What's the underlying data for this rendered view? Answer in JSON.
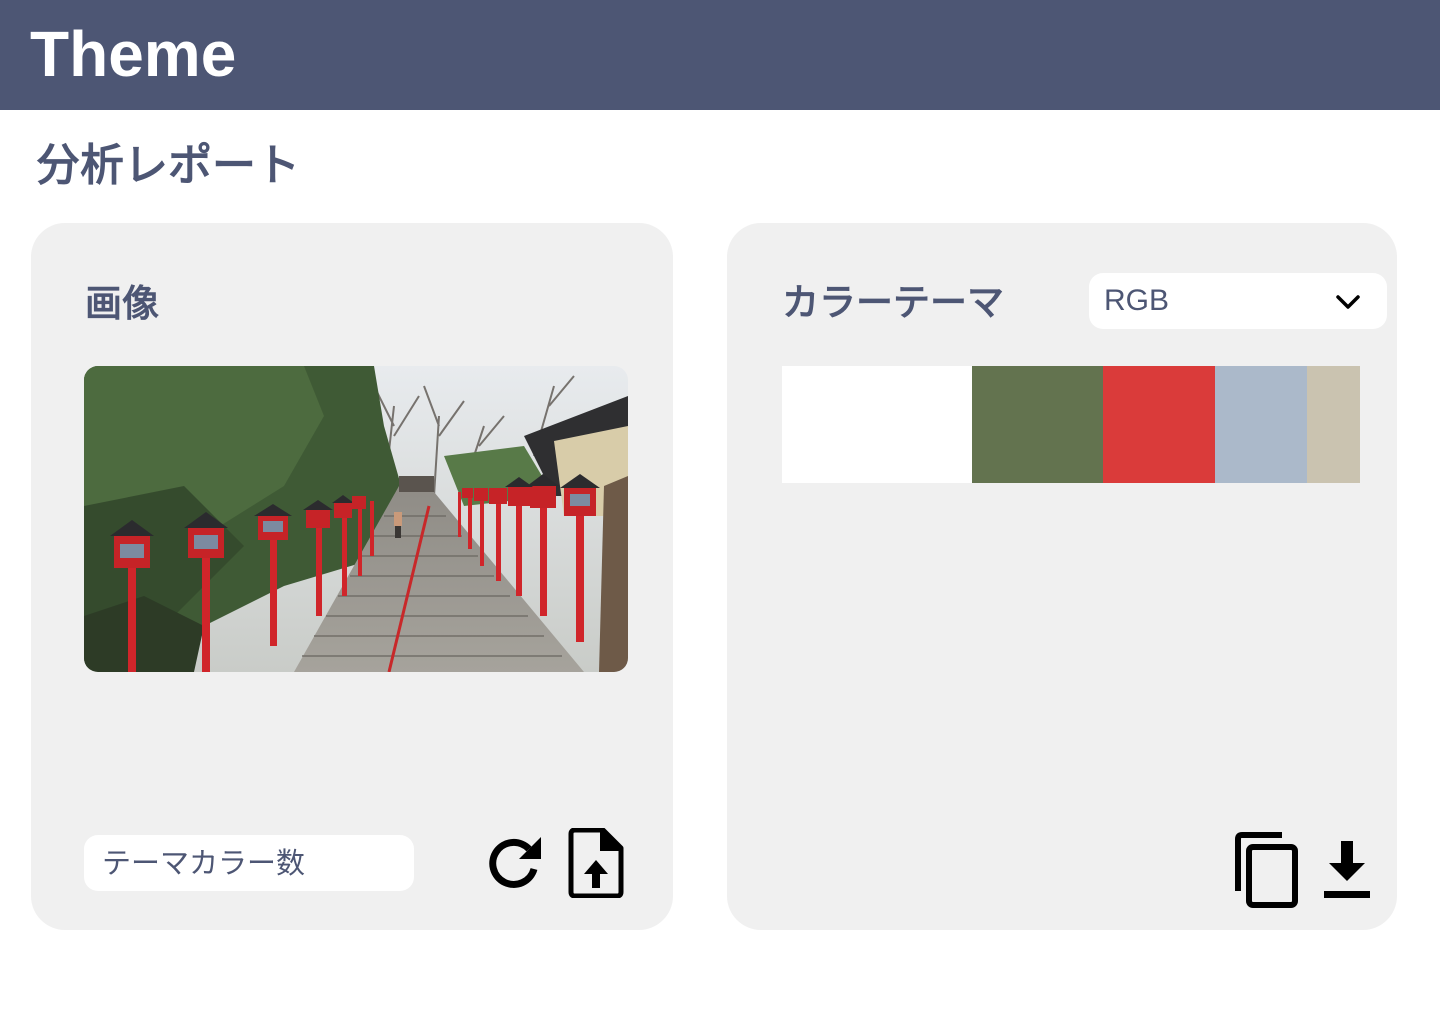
{
  "app": {
    "title": "Theme"
  },
  "page": {
    "title": "分析レポート"
  },
  "image_panel": {
    "heading": "画像",
    "photo_alt": "Shrine stone staircase lined with red lanterns",
    "theme_count_placeholder": "テーマカラー数",
    "icons": {
      "refresh": "refresh-icon",
      "upload": "file-upload-icon"
    }
  },
  "theme_panel": {
    "heading": "カラーテーマ",
    "format_select": {
      "value": "RGB",
      "options": [
        "RGB"
      ]
    },
    "icons": {
      "copy": "copy-icon",
      "download": "download-icon",
      "chevron": "chevron-down-icon"
    },
    "palette": [
      {
        "color": "#ffffff",
        "share": 0.328
      },
      {
        "color": "#63734f",
        "share": 0.228
      },
      {
        "color": "#da3b3a",
        "share": 0.194
      },
      {
        "color": "#abb9ca",
        "share": 0.158
      },
      {
        "color": "#cac3b0",
        "share": 0.092
      }
    ]
  },
  "colors": {
    "header_bg": "#4d5674",
    "accent_text": "#4d5674",
    "card_bg": "#f0f0f0"
  }
}
